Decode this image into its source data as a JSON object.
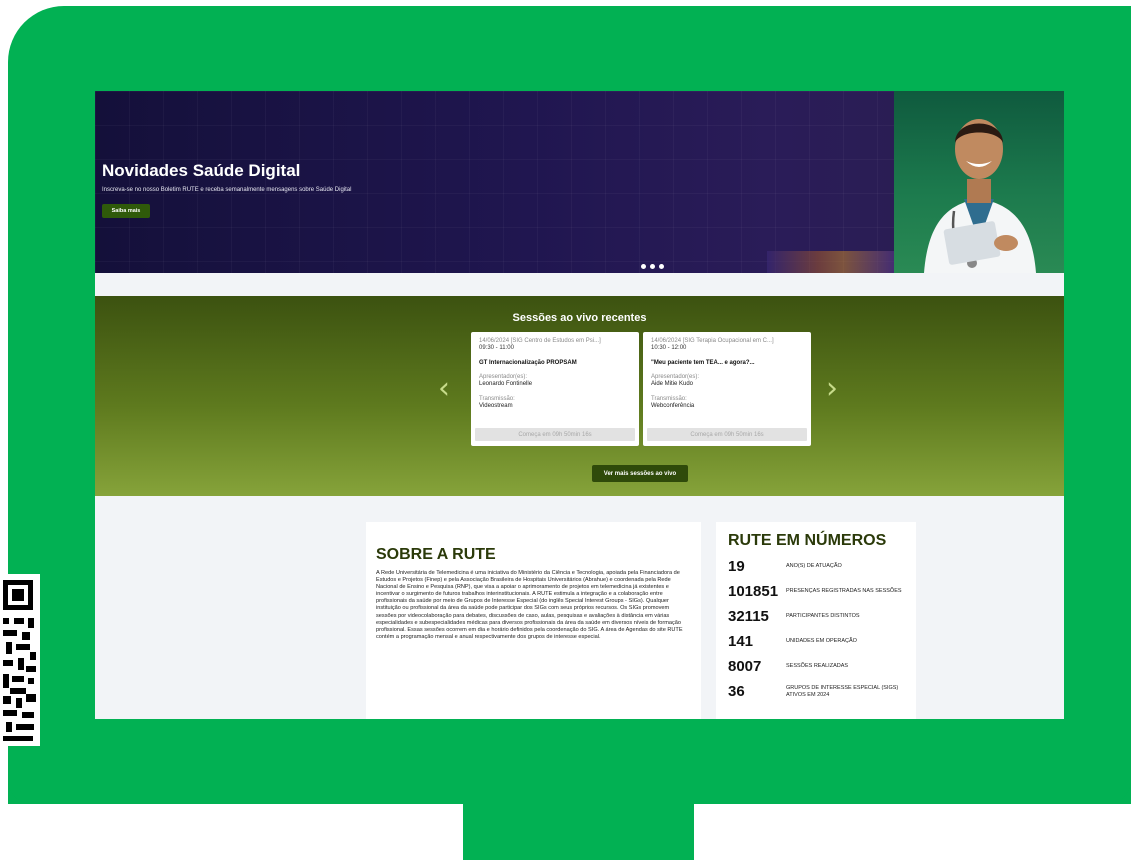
{
  "hero": {
    "title": "Novidades Saúde Digital",
    "subtitle": "Inscreva-se no nosso Boletim RUTE e receba semanalmente mensagens sobre Saúde Digital",
    "button_label": "Saiba mais",
    "slide_count": 3
  },
  "live": {
    "title": "Sessões ao vivo recentes",
    "more_button": "Ver mais sessões ao vivo",
    "cards": [
      {
        "meta": "14/06/2024 [SIG Centro de Estudos em Psi...]",
        "time": "09:30 - 11:00",
        "title": "GT Internacionalização PROPSAM",
        "presenter_label": "Apresentador(es):",
        "presenter": "Leonardo Fontinelle",
        "transmission_label": "Transmissão:",
        "transmission": "Videostream",
        "countdown": "Começa em 09h 50min 16s"
      },
      {
        "meta": "14/06/2024 [SIG Terapia Ocupacional em C...]",
        "time": "10:30 - 12:00",
        "title": "\"Meu paciente tem TEA... e agora?...",
        "presenter_label": "Apresentador(es):",
        "presenter": "Aide Mitie Kudo",
        "transmission_label": "Transmissão:",
        "transmission": "Webconferência",
        "countdown": "Começa em 09h 50min 16s"
      }
    ]
  },
  "about": {
    "title": "SOBRE A RUTE",
    "text": "A Rede Universitária de Telemedicina é uma iniciativa do Ministério da Ciência e Tecnologia, apoiada pela Financiadora de Estudos e Projetos (Finep) e pela Associação Brasileira de Hospitais Universitários (Abrahue) e coordenada pela Rede Nacional de Ensino e Pesquisa (RNP), que visa a apoiar o aprimoramento de projetos em telemedicina já existentes e incentivar o surgimento de futuros trabalhos interinstitucionais. A RUTE estimula a integração e a colaboração entre profissionais da saúde por meio de Grupos de Interesse Especial (do inglês Special Interest Groups - SIGs). Qualquer instituição ou profissional da área da saúde pode participar dos SIGs com seus próprios recursos. Os SIGs promovem sessões por videocolaboração para debates, discussões de caso, aulas, pesquisas e avaliações à distância em várias especialidades e subespecialidades médicas para diversos profissionais da área da saúde em diversos níveis de formação profissional. Essas sessões ocorrem em dia e horário definidos pela coordenação do SIG. A área de Agendas do site RUTE contém a programação mensal e anual respectivamente dos grupos de interesse especial."
  },
  "stats": {
    "title_bold": "RUTE",
    "title_rest": " EM NÚMEROS",
    "items": [
      {
        "value": "19",
        "label": "ANO(S) DE ATUAÇÃO"
      },
      {
        "value": "101851",
        "label": "PRESENÇAS REGISTRADAS NAS SESSÕES"
      },
      {
        "value": "32115",
        "label": "PARTICIPANTES DISTINTOS"
      },
      {
        "value": "141",
        "label": "UNIDADES EM OPERAÇÃO"
      },
      {
        "value": "8007",
        "label": "SESSÕES REALIZADAS"
      },
      {
        "value": "36",
        "label": "GRUPOS DE INTERESSE ESPECIAL (SIGS) ATIVOS EM 2024"
      }
    ]
  },
  "icons": {
    "prev": "chevron-left-icon",
    "next": "chevron-right-icon"
  },
  "colors": {
    "frame": "#02b153",
    "accent_green": "#2f4a0a",
    "hero_bg": "#1d1548"
  }
}
